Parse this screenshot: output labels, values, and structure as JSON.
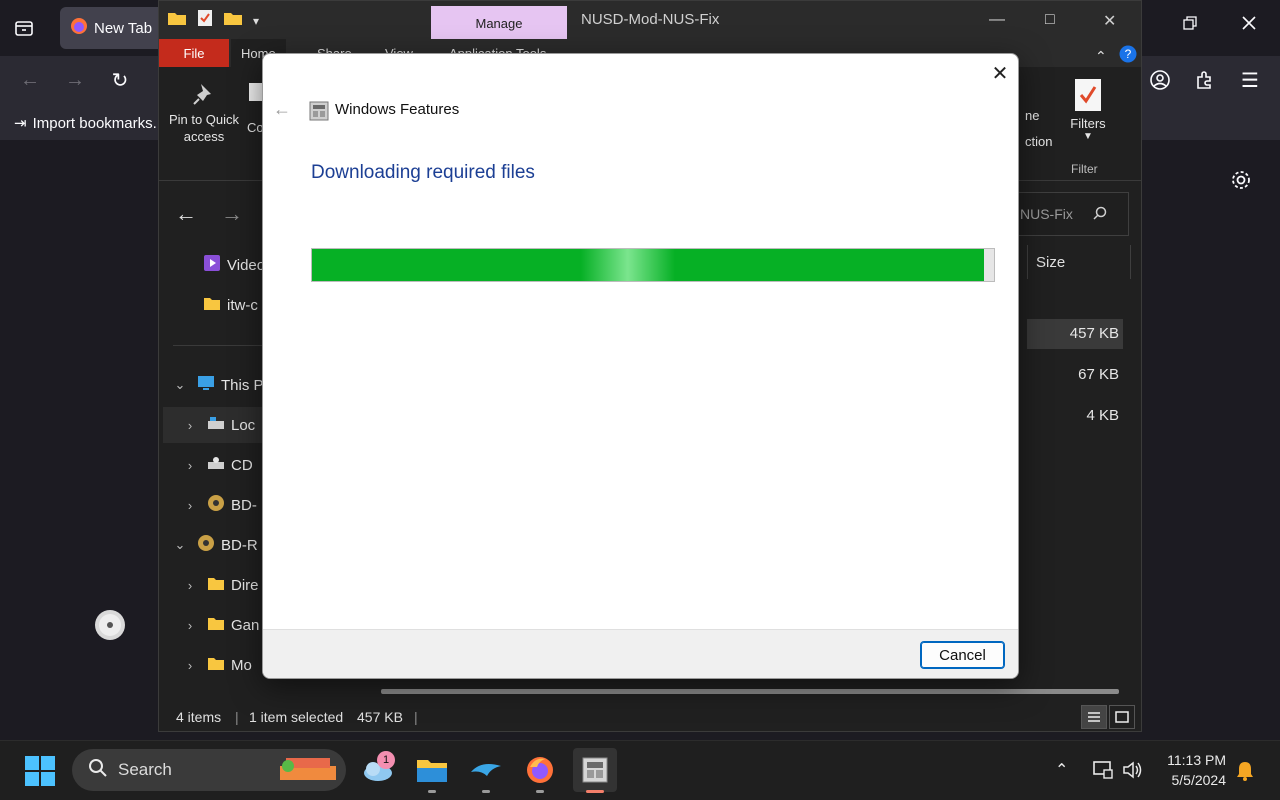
{
  "browser": {
    "tab_title": "New Tab",
    "import_bookmarks": "Import bookmarks..."
  },
  "explorer": {
    "manage_tab": "Manage",
    "window_title": "NUSD-Mod-NUS-Fix",
    "ribbon_tabs": [
      "File",
      "Home",
      "Share",
      "View",
      "Application Tools"
    ],
    "pin_label": "Pin to Quick access",
    "copy_label": "Co",
    "select_label_1": "ne",
    "select_label_2": "ction",
    "filters_label": "Filters",
    "filter_group": "Filter",
    "search_text": "NUS-Fix",
    "column_size": "Size",
    "sizes": [
      "457 KB",
      "67 KB",
      "4 KB"
    ],
    "nav": [
      {
        "label": "Video"
      },
      {
        "label": "itw-c"
      },
      {
        "label": "This P"
      },
      {
        "label": "Loc"
      },
      {
        "label": "CD"
      },
      {
        "label": "BD-"
      },
      {
        "label": "BD-R"
      },
      {
        "label": "Dire"
      },
      {
        "label": "Gan"
      },
      {
        "label": "Mo"
      }
    ],
    "status_items": "4 items",
    "status_selected": "1 item selected",
    "status_size": "457 KB"
  },
  "dialog": {
    "app_title": "Windows Features",
    "heading": "Downloading required files",
    "progress": 0.985,
    "cancel_label": "Cancel"
  },
  "taskbar": {
    "search_label": "Search",
    "notification_count": "1",
    "time": "11:13 PM",
    "date": "5/5/2024"
  },
  "colors": {
    "progress_green": "#06b025",
    "dialog_heading": "#1c3f94",
    "file_tab_red": "#c42b1c",
    "manage_tab": "#e6c5f2"
  }
}
